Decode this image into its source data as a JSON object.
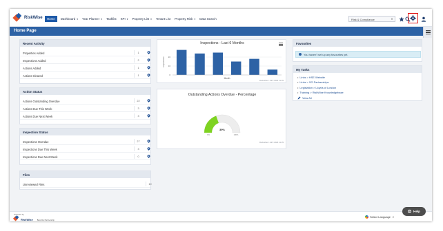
{
  "app": {
    "logo_text": "RiskWise"
  },
  "nav": {
    "items": [
      {
        "label": "Home",
        "active": true,
        "caret": false
      },
      {
        "label": "Dashboard",
        "active": false,
        "caret": true
      },
      {
        "label": "Year Planner",
        "active": false,
        "caret": true
      },
      {
        "label": "Taskfist",
        "active": false,
        "caret": false
      },
      {
        "label": "KPI",
        "active": false,
        "caret": true
      },
      {
        "label": "Property List",
        "active": false,
        "caret": true
      },
      {
        "label": "Tenant List",
        "active": false,
        "caret": false
      },
      {
        "label": "Property Risk",
        "active": false,
        "caret": true
      },
      {
        "label": "Data Search",
        "active": false,
        "caret": false
      }
    ],
    "client_select": "Risk & Compliance"
  },
  "page": {
    "title": "Home Page"
  },
  "recent_activity": {
    "title": "Recent Activity",
    "rows": [
      {
        "label": "Properties Added",
        "value": "1"
      },
      {
        "label": "Inspections Added",
        "value": "2"
      },
      {
        "label": "Actions Added",
        "value": "1"
      },
      {
        "label": "Actions Cleared",
        "value": "1"
      }
    ]
  },
  "action_status": {
    "title": "Action Status",
    "rows": [
      {
        "label": "Actions Outstanding Overdue",
        "value": "22"
      },
      {
        "label": "Actions Due This Week",
        "value": "3"
      },
      {
        "label": "Actions Due Next Week",
        "value": "3"
      }
    ]
  },
  "inspection_status": {
    "title": "Inspection Status",
    "rows": [
      {
        "label": "Inspections Overdue",
        "value": "27"
      },
      {
        "label": "Inspections Due This Week",
        "value": "3"
      },
      {
        "label": "Inspections Due Next Week",
        "value": "0"
      }
    ]
  },
  "files": {
    "title": "Files",
    "rows": [
      {
        "label": "Unreviewed Files",
        "value": "10"
      }
    ]
  },
  "inspections_chart": {
    "updated": "Refreshed: Jul 8 2024 11:29"
  },
  "overdue_chart": {
    "updated": "Refreshed: Jul 8 2024 11:29"
  },
  "favourites": {
    "title": "Favourites",
    "message": "You haven't set up any favourites yet."
  },
  "my_tasks": {
    "title": "My Tasks",
    "items": [
      "Links > HSE Website",
      "Links > SG Partnerships",
      "Legislation > Lloyds of London",
      "Training > RiskWise Knowledgebase"
    ],
    "view_all": "View All"
  },
  "footer": {
    "powered_by": "Powered by",
    "tagline": "Best-fits Partnership",
    "language": "Select Language",
    "help": "Help"
  },
  "colors": {
    "brand": "#2d62a5",
    "gauge_fill": "#7ed321",
    "highlight_box": "#e11b1b"
  },
  "chart_data": [
    {
      "type": "bar",
      "title": "Inspections - Last 6 Months",
      "xlabel": "Month",
      "ylabel": "Inspections",
      "categories": [
        "",
        "",
        "",
        "",
        "",
        ""
      ],
      "values": [
        28,
        24,
        25,
        15,
        18,
        6
      ],
      "ylim": [
        0,
        30
      ],
      "yticks": [
        "20",
        "10",
        "0"
      ],
      "bar_color": "#2d62a5",
      "grid": true
    },
    {
      "type": "gauge",
      "title": "Outstanding Actions Overdue - Percentage",
      "value": 39,
      "value_label": "39%",
      "min_label": "0%",
      "max_label": "100%"
    }
  ]
}
